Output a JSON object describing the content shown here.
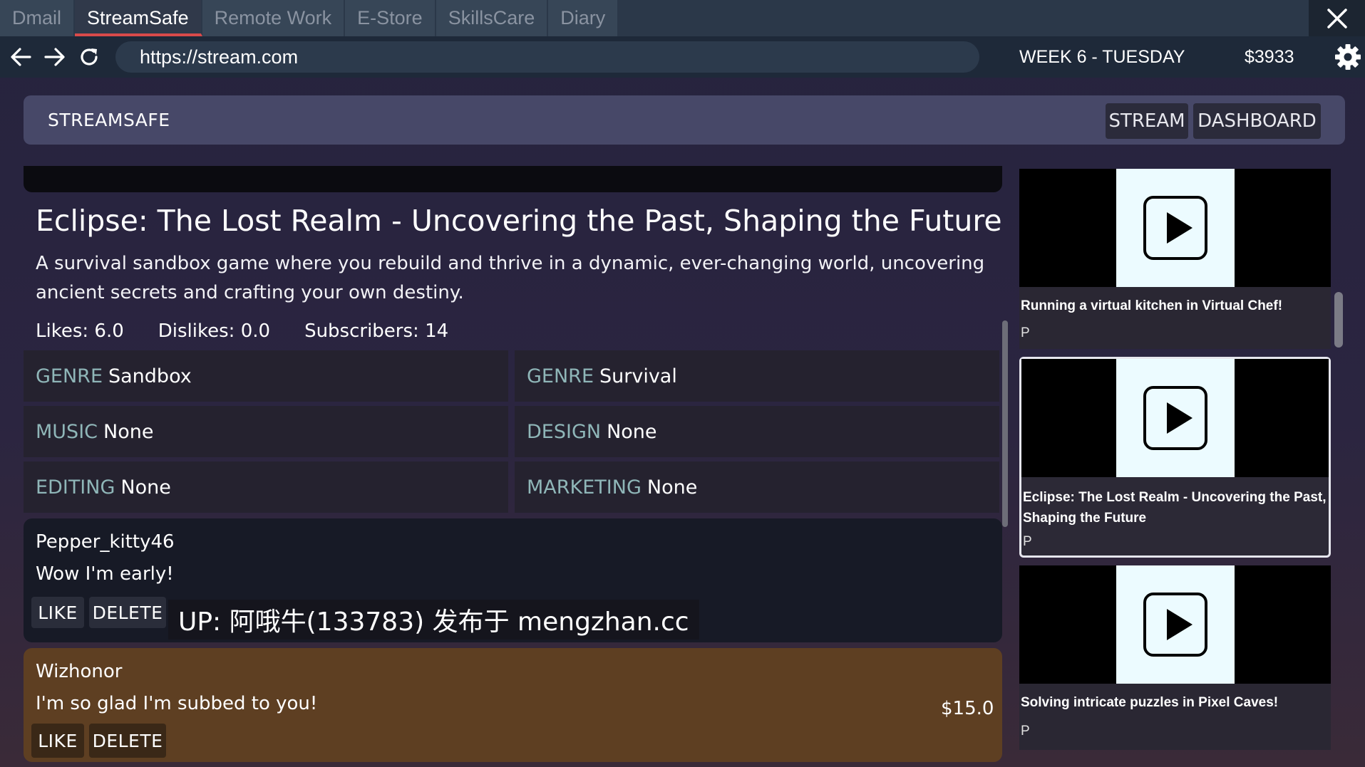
{
  "browser": {
    "tabs": [
      {
        "label": "Dmail"
      },
      {
        "label": "StreamSafe"
      },
      {
        "label": "Remote Work"
      },
      {
        "label": "E-Store"
      },
      {
        "label": "SkillsCare"
      },
      {
        "label": "Diary"
      }
    ],
    "active_tab": "StreamSafe",
    "url": "https://stream.com",
    "week": "WEEK 6 - TUESDAY",
    "money": "$3933"
  },
  "site": {
    "brand": "STREAMSAFE",
    "nav": {
      "stream": "STREAM",
      "dashboard": "DASHBOARD"
    }
  },
  "video": {
    "title": "Eclipse: The Lost Realm - Uncovering the Past, Shaping the Future",
    "description": "A survival sandbox game where you rebuild and thrive in a dynamic, ever-changing world, uncovering ancient secrets and crafting your own destiny.",
    "likes": "Likes: 6.0",
    "dislikes": "Dislikes: 0.0",
    "subscribers": "Subscribers: 14",
    "attributes": [
      {
        "key": "GENRE",
        "value": "Sandbox"
      },
      {
        "key": "GENRE",
        "value": "Survival"
      },
      {
        "key": "MUSIC",
        "value": "None"
      },
      {
        "key": "DESIGN",
        "value": "None"
      },
      {
        "key": "EDITING",
        "value": "None"
      },
      {
        "key": "MARKETING",
        "value": "None"
      }
    ]
  },
  "comments": [
    {
      "user": "Pepper_kitty46",
      "text": "Wow I'm early!",
      "like": "LIKE",
      "delete": "DELETE",
      "donation": ""
    },
    {
      "user": "Wizhonor",
      "text": "I'm so glad I'm subbed to you!",
      "like": "LIKE",
      "delete": "DELETE",
      "donation": "$15.0"
    }
  ],
  "watermark": "UP: 阿哦牛(133783) 发布于 mengzhan.cc",
  "sidebar": [
    {
      "title": "Running a virtual kitchen in Virtual Chef!",
      "meta": "P"
    },
    {
      "title": "Eclipse: The Lost Realm - Uncovering the Past, Shaping the Future",
      "meta": "P"
    },
    {
      "title": "Solving intricate puzzles in Pixel Caves!",
      "meta": "P"
    }
  ],
  "colors": {
    "active_tab_underline": "#d94a4a",
    "attribute_key": "#8fb6b8",
    "donation_comment_bg": "#5e3f22",
    "thumbnail_bg": "#ecfbff"
  },
  "icons": [
    "back-arrow-icon",
    "forward-arrow-icon",
    "reload-icon",
    "close-icon",
    "gear-icon",
    "play-icon"
  ]
}
